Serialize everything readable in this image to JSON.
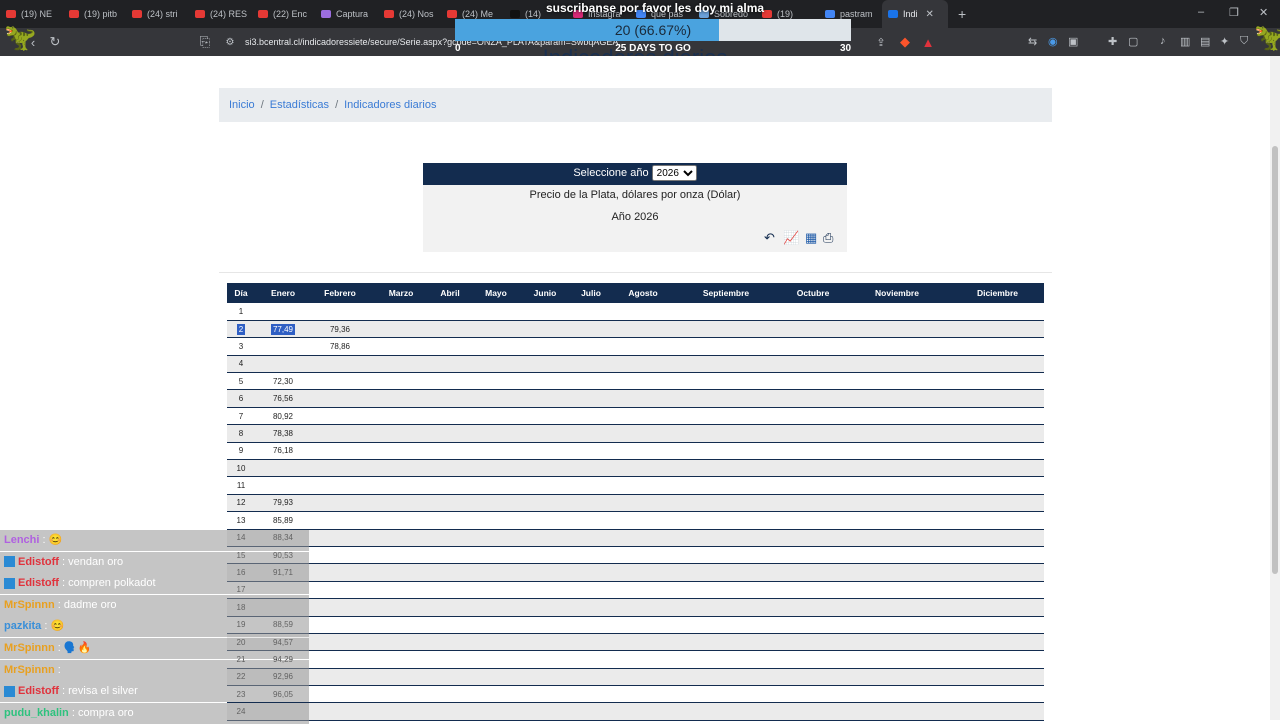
{
  "browser": {
    "tabs": [
      {
        "label": "(19) NE",
        "color": "#e53935"
      },
      {
        "label": "(19) pitb",
        "color": "#e53935"
      },
      {
        "label": "(24) stri",
        "color": "#e53935"
      },
      {
        "label": "(24) RES",
        "color": "#e53935"
      },
      {
        "label": "(22) Enc",
        "color": "#e53935"
      },
      {
        "label": "Captura",
        "color": "#9c6ee0"
      },
      {
        "label": "(24) Nos",
        "color": "#e53935"
      },
      {
        "label": "(24) Me",
        "color": "#e53935"
      },
      {
        "label": "(14)",
        "color": "#111111"
      },
      {
        "label": "Instagra",
        "color": "#d62976"
      },
      {
        "label": "que pas",
        "color": "#4285f4"
      },
      {
        "label": "Sobredo",
        "color": "#6aa0d8"
      },
      {
        "label": "(19)",
        "color": "#e53935"
      },
      {
        "label": "pastram",
        "color": "#4285f4"
      },
      {
        "label": "Indi",
        "color": "#1a73e8",
        "active": true
      }
    ],
    "new_tab": "+",
    "url": "si3.bcentral.cl/indicadoressiete/secure/Serie.aspx?gcode=ONZA_PLATA&param=SwbqAGEA...",
    "window_controls": [
      "–",
      "❐",
      "✕"
    ]
  },
  "overlay": {
    "title": "suscribanse por favor les doy mi alma",
    "progress_text": "20 (66.67%)",
    "progress_fraction": 0.6667,
    "min": "0",
    "max": "30",
    "days": "25 DAYS TO GO"
  },
  "page": {
    "heading": "Indicadores diarios",
    "breadcrumb": [
      "Inicio",
      "Estadísticas",
      "Indicadores diarios"
    ],
    "breadcrumb_sep": "/",
    "year_label": "Seleccione año",
    "year_value": "2026",
    "subtitle": "Precio de la Plata, dólares por onza (Dólar)",
    "year_text": "Año 2026",
    "icons": [
      "back-icon",
      "chart-icon",
      "excel-icon",
      "print-icon"
    ]
  },
  "table": {
    "headers": [
      "Día",
      "Enero",
      "Febrero",
      "Marzo",
      "Abril",
      "Mayo",
      "Junio",
      "Julio",
      "Agosto",
      "Septiembre",
      "Octubre",
      "Noviembre",
      "Diciembre"
    ],
    "rows": [
      [
        "1",
        "",
        ""
      ],
      [
        "2",
        "77,49",
        "79,36"
      ],
      [
        "3",
        "",
        "78,86"
      ],
      [
        "4",
        "",
        ""
      ],
      [
        "5",
        "72,30",
        ""
      ],
      [
        "6",
        "76,56",
        ""
      ],
      [
        "7",
        "80,92",
        ""
      ],
      [
        "8",
        "78,38",
        ""
      ],
      [
        "9",
        "76,18",
        ""
      ],
      [
        "10",
        "",
        ""
      ],
      [
        "11",
        "",
        ""
      ],
      [
        "12",
        "79,93",
        ""
      ],
      [
        "13",
        "85,89",
        ""
      ],
      [
        "14",
        "88,34",
        ""
      ],
      [
        "15",
        "90,53",
        ""
      ],
      [
        "16",
        "91,71",
        ""
      ],
      [
        "17",
        "",
        ""
      ],
      [
        "18",
        "",
        ""
      ],
      [
        "19",
        "88,59",
        ""
      ],
      [
        "20",
        "94,57",
        ""
      ],
      [
        "21",
        "94,29",
        ""
      ],
      [
        "22",
        "92,96",
        ""
      ],
      [
        "23",
        "96,05",
        ""
      ],
      [
        "24",
        "",
        ""
      ]
    ]
  },
  "chat": [
    {
      "user": "Lenchi",
      "text": ": 😊",
      "color": "#b061e0",
      "badge": false
    },
    {
      "user": "Edistoff",
      "text": ": vendan oro",
      "color": "#e0323c",
      "badge": true
    },
    {
      "user": "Edistoff",
      "text": ": compren polkadot",
      "color": "#e0323c",
      "badge": true
    },
    {
      "user": "MrSpinnn",
      "text": ": dadme oro",
      "color": "#e8a020",
      "badge": false
    },
    {
      "user": "pazkita",
      "text": ": 😊",
      "color": "#3a8fd8",
      "badge": false
    },
    {
      "user": "MrSpinnn",
      "text": ": 🗣️🔥",
      "color": "#e8a020",
      "badge": false
    },
    {
      "user": "MrSpinnn",
      "text": ":",
      "color": "#e8a020",
      "badge": false
    },
    {
      "user": "Edistoff",
      "text": ": revisa el silver",
      "color": "#e0323c",
      "badge": true
    },
    {
      "user": "pudu_khalin",
      "text": ": compra oro",
      "color": "#2ec27e",
      "badge": false
    }
  ]
}
